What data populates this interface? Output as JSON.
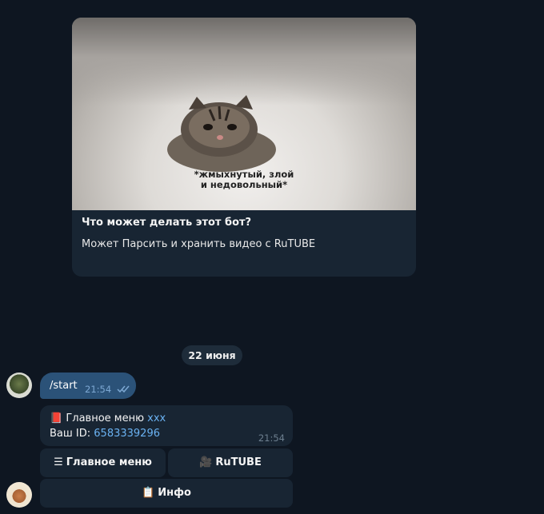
{
  "bot_intro": {
    "image_caption_line1": "*жмыхнутый, злой",
    "image_caption_line2": "и недовольный*",
    "title": "Что может делать этот бот?",
    "description": "Может Парсить  и хранить видео с RuTUBE"
  },
  "date_separator": "22 июня",
  "outgoing_message": {
    "text": "/start",
    "time": "21:54",
    "status": "read"
  },
  "incoming_message": {
    "emoji": "📕",
    "title": "Главное меню",
    "title_suffix": "xxx",
    "id_label": "Ваш ID:",
    "id_value": "6583339296",
    "time": "21:54"
  },
  "keyboard": {
    "main_menu_icon": "☰",
    "main_menu_label": "Главное меню",
    "rutube_icon": "🎥",
    "rutube_label": "RuTUBE",
    "info_icon": "📋",
    "info_label": "Инфо"
  },
  "colors": {
    "background": "#0e1621",
    "incoming_bubble": "#182533",
    "outgoing_bubble": "#2b5278",
    "link": "#6ab2f2"
  }
}
